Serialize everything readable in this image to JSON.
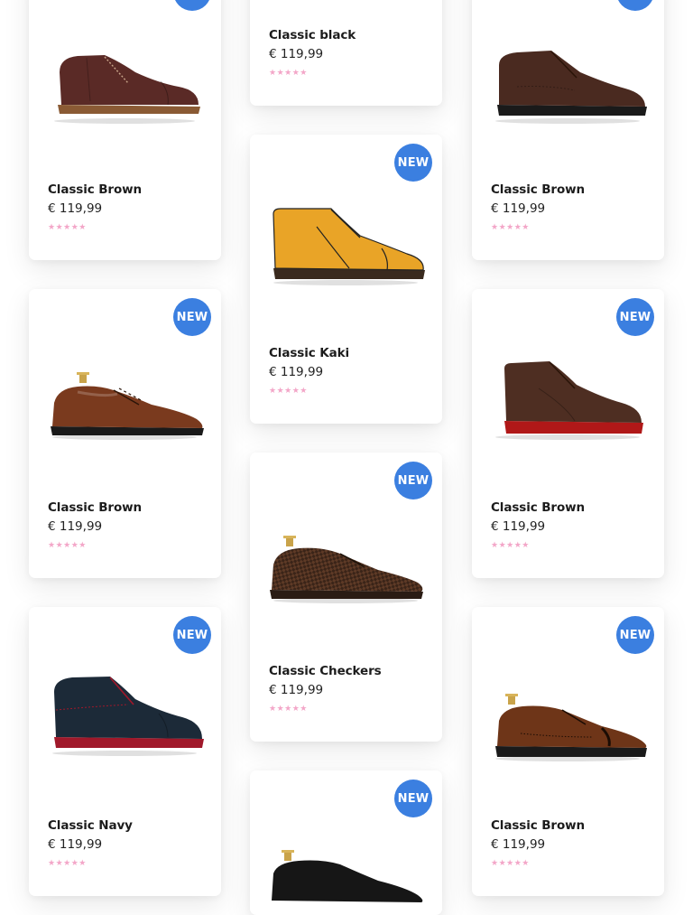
{
  "badge": {
    "label": "NEW",
    "bg": "#3b7fe0",
    "fg": "#ffffff"
  },
  "star_color": "#f3a6c8",
  "products": [
    {
      "name": "Classic Brown",
      "price": "€ 119,99",
      "rating": "★★★★★",
      "badge": true,
      "shoe_icon": "brown-chukka-boot-icon",
      "upper": "#5a2a26",
      "sole": "#8a5a34"
    },
    {
      "name": "Classic black",
      "price": "€ 119,99",
      "rating": "★★★★★",
      "badge": false,
      "shoe_icon": "black-shoe-icon",
      "upper": "#1e1e1e",
      "sole": "#3a2a20"
    },
    {
      "name": "Classic Brown",
      "price": "€ 119,99",
      "rating": "★★★★★",
      "badge": true,
      "shoe_icon": "brown-chukka-boot-icon",
      "upper": "#4a2a20",
      "sole": "#1a1a1a"
    },
    {
      "name": "Classic Kaki",
      "price": "€ 119,99",
      "rating": "★★★★★",
      "badge": true,
      "shoe_icon": "yellow-chukka-boot-icon",
      "upper": "#e9a427",
      "sole": "#3a2a1e"
    },
    {
      "name": "Classic Brown",
      "price": "€ 119,99",
      "rating": "★★★★★",
      "badge": true,
      "shoe_icon": "brown-oxford-shoe-icon",
      "upper": "#7a3a1e",
      "sole": "#1a1a1a"
    },
    {
      "name": "Classic Brown",
      "price": "€ 119,99",
      "rating": "★★★★★",
      "badge": true,
      "shoe_icon": "brown-chukka-boot-icon",
      "upper": "#4e2e22",
      "sole": "#b01818"
    },
    {
      "name": "Classic Checkers",
      "price": "€ 119,99",
      "rating": "★★★★★",
      "badge": true,
      "shoe_icon": "woven-derby-shoe-icon",
      "upper": "#5e3a26",
      "sole": "#2a1c14"
    },
    {
      "name": "Classic Navy",
      "price": "€ 119,99",
      "rating": "★★★★★",
      "badge": true,
      "shoe_icon": "navy-chukka-boot-icon",
      "upper": "#1c2a38",
      "sole": "#a0182a"
    },
    {
      "name": "Classic Brown",
      "price": "€ 119,99",
      "rating": "★★★★★",
      "badge": true,
      "shoe_icon": "brown-brogue-shoe-icon",
      "upper": "#6e3518",
      "sole": "#1a1a1a"
    },
    {
      "name": "",
      "price": "",
      "rating": "",
      "badge": true,
      "shoe_icon": "black-oxford-shoe-icon",
      "upper": "#161616",
      "sole": "#2a2a2a"
    }
  ]
}
